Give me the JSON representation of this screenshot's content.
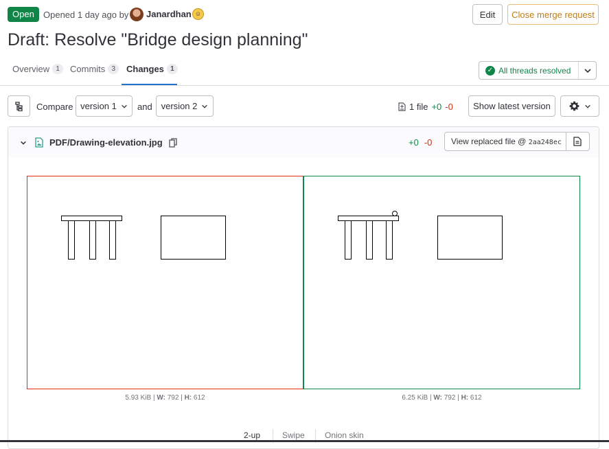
{
  "header": {
    "status": "Open",
    "opened_text": "Opened 1 day ago by",
    "author": "Janardhan",
    "edit_label": "Edit",
    "close_label": "Close merge request",
    "title": "Draft: Resolve \"Bridge design planning\""
  },
  "tabs": [
    {
      "label": "Overview",
      "count": "1"
    },
    {
      "label": "Commits",
      "count": "3"
    },
    {
      "label": "Changes",
      "count": "1",
      "active": true
    }
  ],
  "threads": {
    "label": "All threads resolved"
  },
  "compare": {
    "label": "Compare",
    "from_version": "version 1",
    "and_label": "and",
    "to_version": "version 2",
    "file_count": "1 file",
    "added": "+0",
    "removed": "-0",
    "show_latest_label": "Show latest version"
  },
  "file": {
    "path": "PDF/Drawing-elevation.jpg",
    "added": "+0",
    "removed": "-0",
    "view_replaced_label": "View replaced file @",
    "replaced_sha": "2aa248ec"
  },
  "images": {
    "old": {
      "size": "5.93 KiB",
      "w_label": "W:",
      "w": "792",
      "h_label": "H:",
      "h": "612"
    },
    "new": {
      "size": "6.25 KiB",
      "w_label": "W:",
      "w": "792",
      "h_label": "H:",
      "h": "612"
    }
  },
  "view_modes": [
    "2-up",
    "Swipe",
    "Onion skin"
  ],
  "colors": {
    "open_badge": "#108548",
    "added": "#108548",
    "removed": "#dd2b0e",
    "accent": "#1f75cb",
    "close_button": "#c17d10"
  },
  "icons": [
    "avatar",
    "emoji-icon",
    "chevron-down-icon",
    "check-circle-icon",
    "file-tree-icon",
    "file-diff-icon",
    "gear-icon",
    "copy-icon",
    "image-file-icon",
    "document-icon"
  ]
}
